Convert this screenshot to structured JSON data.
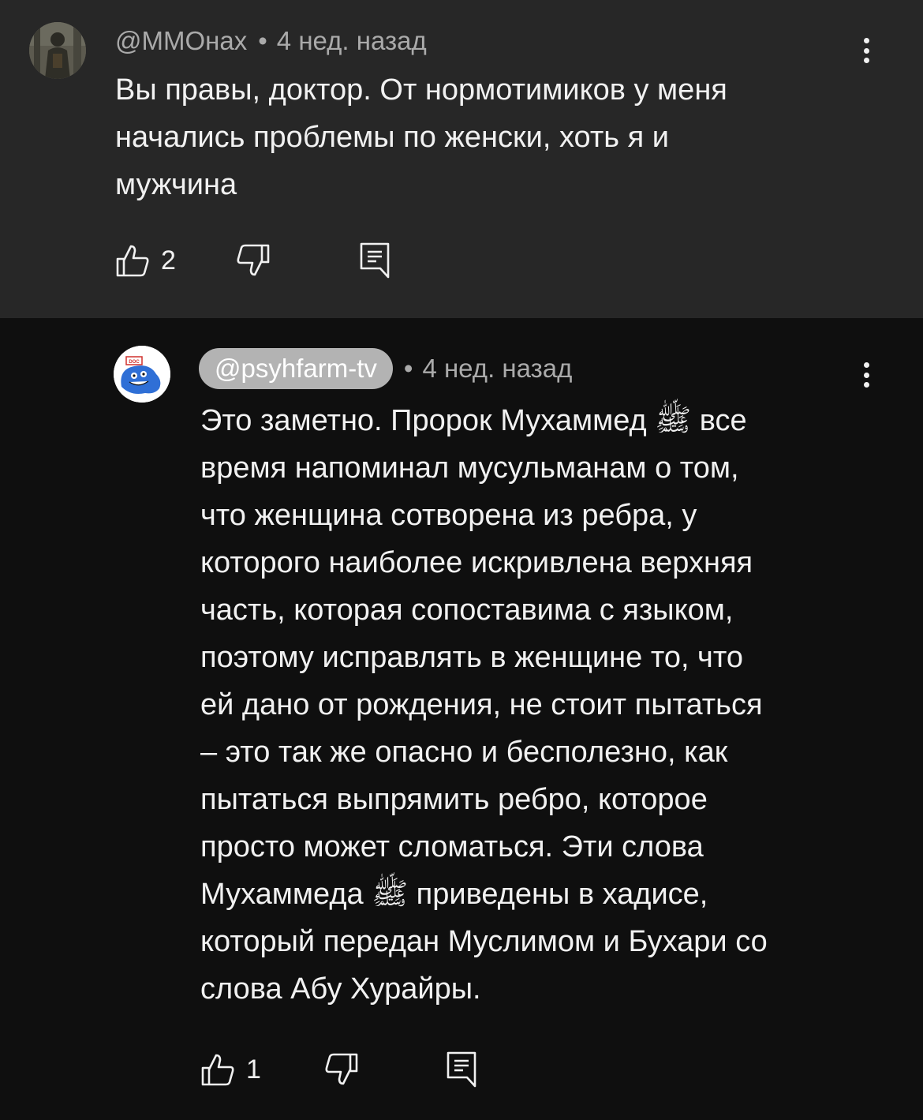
{
  "comments": [
    {
      "author": "@ММОнах",
      "time": "4 нед. назад",
      "text": "Вы правы, доктор. От нормотимиков у меня\nначались проблемы по женски, хоть я и\nмужчина",
      "likes": "2",
      "avatar_icon": "user-photo-avatar"
    },
    {
      "author": "@psyhfarm-tv",
      "time": "4 нед. назад",
      "text": "Это заметно. Пророк Мухаммед ﷺ все\nвремя напоминал мусульманам о том,\nчто женщина сотворена из ребра, у\nкоторого наиболее искривлена верхняя\nчасть, которая сопоставима с языком,\nпоэтому исправлять в женщине то, что\nей дано от рождения, не стоит пытаться\n– это так же опасно и бесполезно, как\nпытаться выпрямить ребро, которое\nпросто может сломаться. Эти слова\nМухаммеда ﷺ приведены в хадисе,\nкоторый передан Муслимом и Бухари со\nслова Абу Хурайры.",
      "likes": "1",
      "avatar_icon": "blue-monster-doc-avatar"
    }
  ],
  "separator": "•",
  "colors": {
    "reply_bg": "#272727",
    "page_bg": "#0f0f0f",
    "text": "#f1f1f1",
    "meta": "#aaaaaa",
    "author_pill": "#b3b3b3"
  }
}
